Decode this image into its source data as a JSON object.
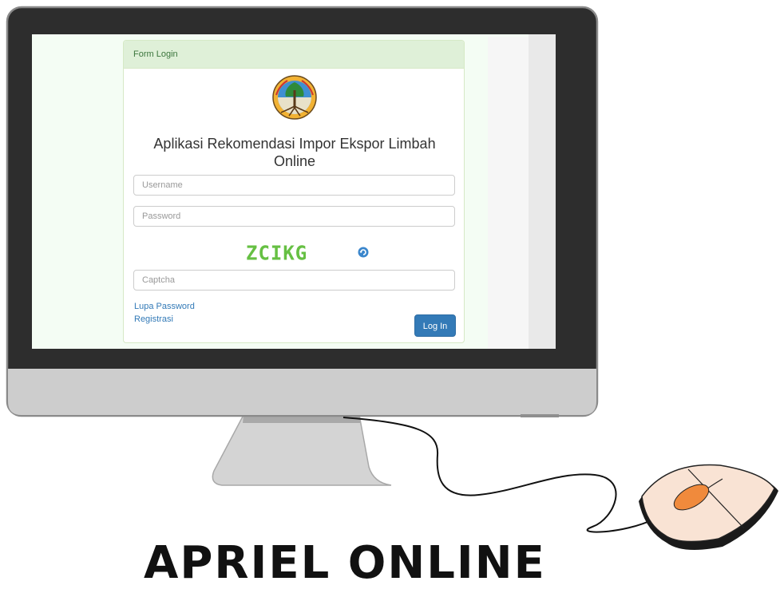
{
  "login_panel": {
    "heading": "Form Login",
    "app_title_line1": "Aplikasi Rekomendasi Impor Ekspor Limbah",
    "app_title_line2": "Online",
    "username_placeholder": "Username",
    "password_placeholder": "Password",
    "captcha_code": "ZCIKG",
    "captcha_placeholder": "Captcha",
    "forgot_password_link": "Lupa Password",
    "register_link": "Registrasi",
    "login_button": "Log In"
  },
  "banner": {
    "text": "APRIEL ONLINE"
  },
  "colors": {
    "panel_heading_bg": "#dff0d8",
    "captcha_green": "#66c043",
    "primary_button": "#337ab7",
    "link": "#337ab7",
    "mouse_body": "#f9e3d4",
    "mouse_wheel": "#f08a3c",
    "monitor_bezel": "#2d2d2d",
    "monitor_chin": "#cdcdcd"
  },
  "icons": {
    "logo": "ministry-emblem-icon",
    "captcha_refresh": "refresh-icon"
  }
}
